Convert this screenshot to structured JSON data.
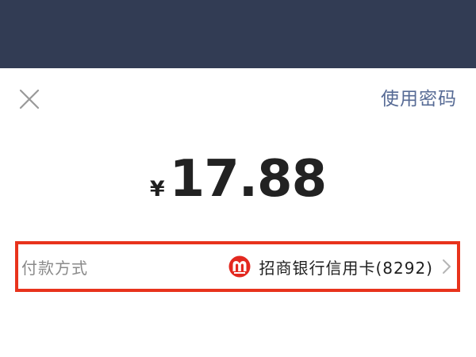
{
  "header": {
    "close_icon": "close-icon",
    "use_password_label": "使用密码"
  },
  "payment": {
    "currency_symbol": "¥",
    "amount": "17.88"
  },
  "payment_method": {
    "label": "付款方式",
    "bank_icon": "cmb-bank-logo-icon",
    "bank_name": "招商银行信用卡(8292)",
    "chevron_icon": "chevron-right-icon"
  },
  "colors": {
    "top_bar": "#323c54",
    "link": "#576b95",
    "highlight": "#e8331c",
    "bank_logo": "#e3281f"
  }
}
